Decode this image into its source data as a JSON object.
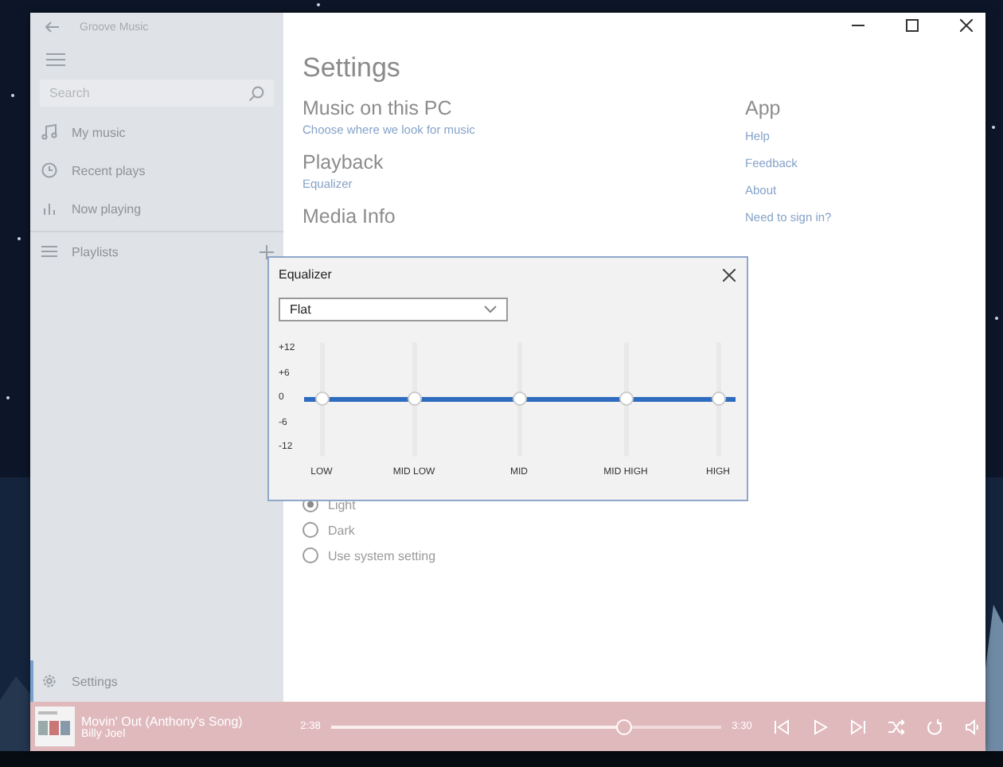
{
  "window": {
    "title": "Groove Music"
  },
  "sidebar": {
    "search": {
      "placeholder": "Search"
    },
    "items": [
      {
        "label": "My music",
        "selected": false
      },
      {
        "label": "Recent plays",
        "selected": false
      },
      {
        "label": "Now playing",
        "selected": false
      }
    ],
    "playlists": {
      "label": "Playlists"
    },
    "settings": {
      "label": "Settings",
      "selected": true
    }
  },
  "settings": {
    "title": "Settings",
    "sections": [
      {
        "heading": "Music on this PC",
        "links": [
          "Choose where we look for music"
        ]
      },
      {
        "heading": "Playback",
        "links": [
          "Equalizer"
        ]
      },
      {
        "heading": "Media Info"
      }
    ],
    "app": {
      "heading": "App",
      "links": [
        "Help",
        "Feedback",
        "About",
        "Need to sign in?"
      ]
    },
    "theme_options": [
      {
        "label": "Light",
        "selected": true
      },
      {
        "label": "Dark",
        "selected": false
      },
      {
        "label": "Use system setting",
        "selected": false
      }
    ]
  },
  "equalizer": {
    "title": "Equalizer",
    "preset": "Flat",
    "scale": [
      "+12",
      "+6",
      "0",
      "-6",
      "-12"
    ],
    "bands": [
      {
        "label": "LOW",
        "level": 0.5
      },
      {
        "label": "MID LOW",
        "level": 0.5
      },
      {
        "label": "MID",
        "level": 0.5
      },
      {
        "label": "MID HIGH",
        "level": 0.5
      },
      {
        "label": "HIGH",
        "level": 0.5
      }
    ]
  },
  "player": {
    "title": "Movin' Out (Anthony's Song)",
    "artist": "Billy Joel",
    "elapsed": "2:38",
    "duration": "3:30",
    "level": 0.75
  }
}
